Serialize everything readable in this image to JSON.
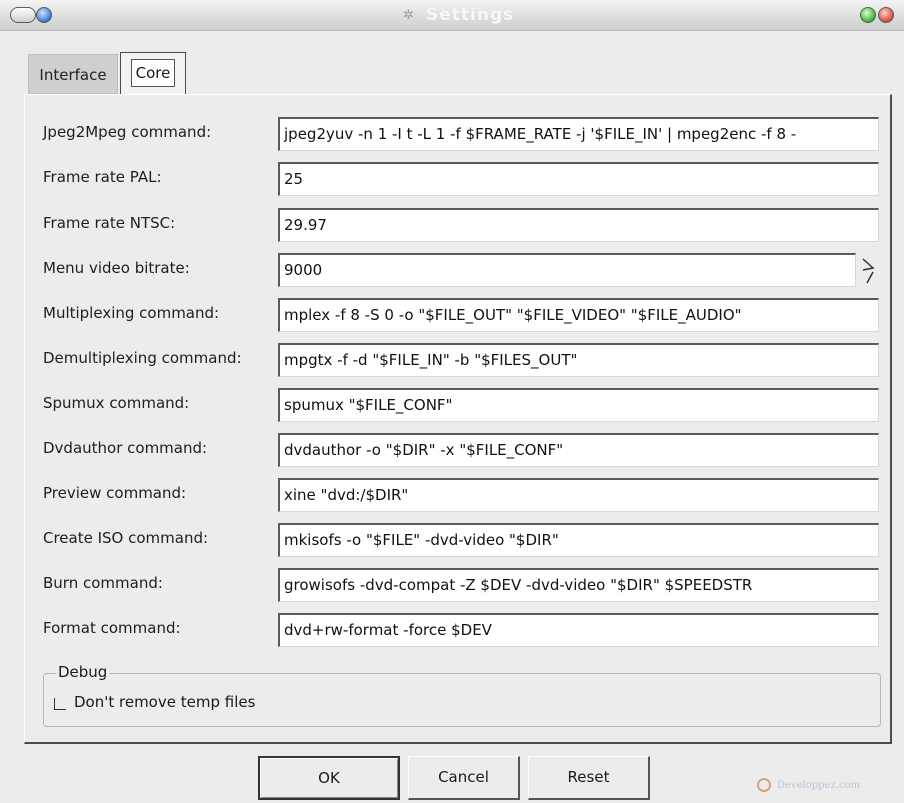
{
  "window": {
    "title": "Settings",
    "app_icon": "dvd-styler-icon"
  },
  "tabs": [
    {
      "label": "Interface",
      "active": false
    },
    {
      "label": "Core",
      "active": true
    }
  ],
  "fields": [
    {
      "label": "Jpeg2Mpeg command:",
      "value": "jpeg2yuv -n 1 -I t -L 1 -f $FRAME_RATE -j '$FILE_IN' | mpeg2enc -f 8 -"
    },
    {
      "label": "Frame rate PAL:",
      "value": "25"
    },
    {
      "label": "Frame rate NTSC:",
      "value": "29.97"
    },
    {
      "label": "Menu video bitrate:",
      "value": "9000"
    },
    {
      "label": "Multiplexing command:",
      "value": "mplex -f 8 -S 0 -o \"$FILE_OUT\" \"$FILE_VIDEO\" \"$FILE_AUDIO\""
    },
    {
      "label": "Demultiplexing command:",
      "value": "mpgtx -f -d \"$FILE_IN\" -b \"$FILES_OUT\""
    },
    {
      "label": "Spumux command:",
      "value": "spumux \"$FILE_CONF\""
    },
    {
      "label": "Dvdauthor command:",
      "value": "dvdauthor -o \"$DIR\" -x \"$FILE_CONF\""
    },
    {
      "label": "Preview command:",
      "value": "xine \"dvd:/$DIR\""
    },
    {
      "label": "Create ISO command:",
      "value": "mkisofs -o \"$FILE\" -dvd-video \"$DIR\""
    },
    {
      "label": "Burn command:",
      "value": "growisofs -dvd-compat -Z $DEV -dvd-video \"$DIR\" $SPEEDSTR"
    },
    {
      "label": "Format command:",
      "value": "dvd+rw-format -force $DEV"
    }
  ],
  "debug": {
    "group_label": "Debug",
    "checkbox_label": "Don't remove temp files",
    "checked": false
  },
  "buttons": {
    "ok": "OK",
    "cancel": "Cancel",
    "reset": "Reset"
  },
  "watermark": {
    "text": "Developpez.com"
  }
}
